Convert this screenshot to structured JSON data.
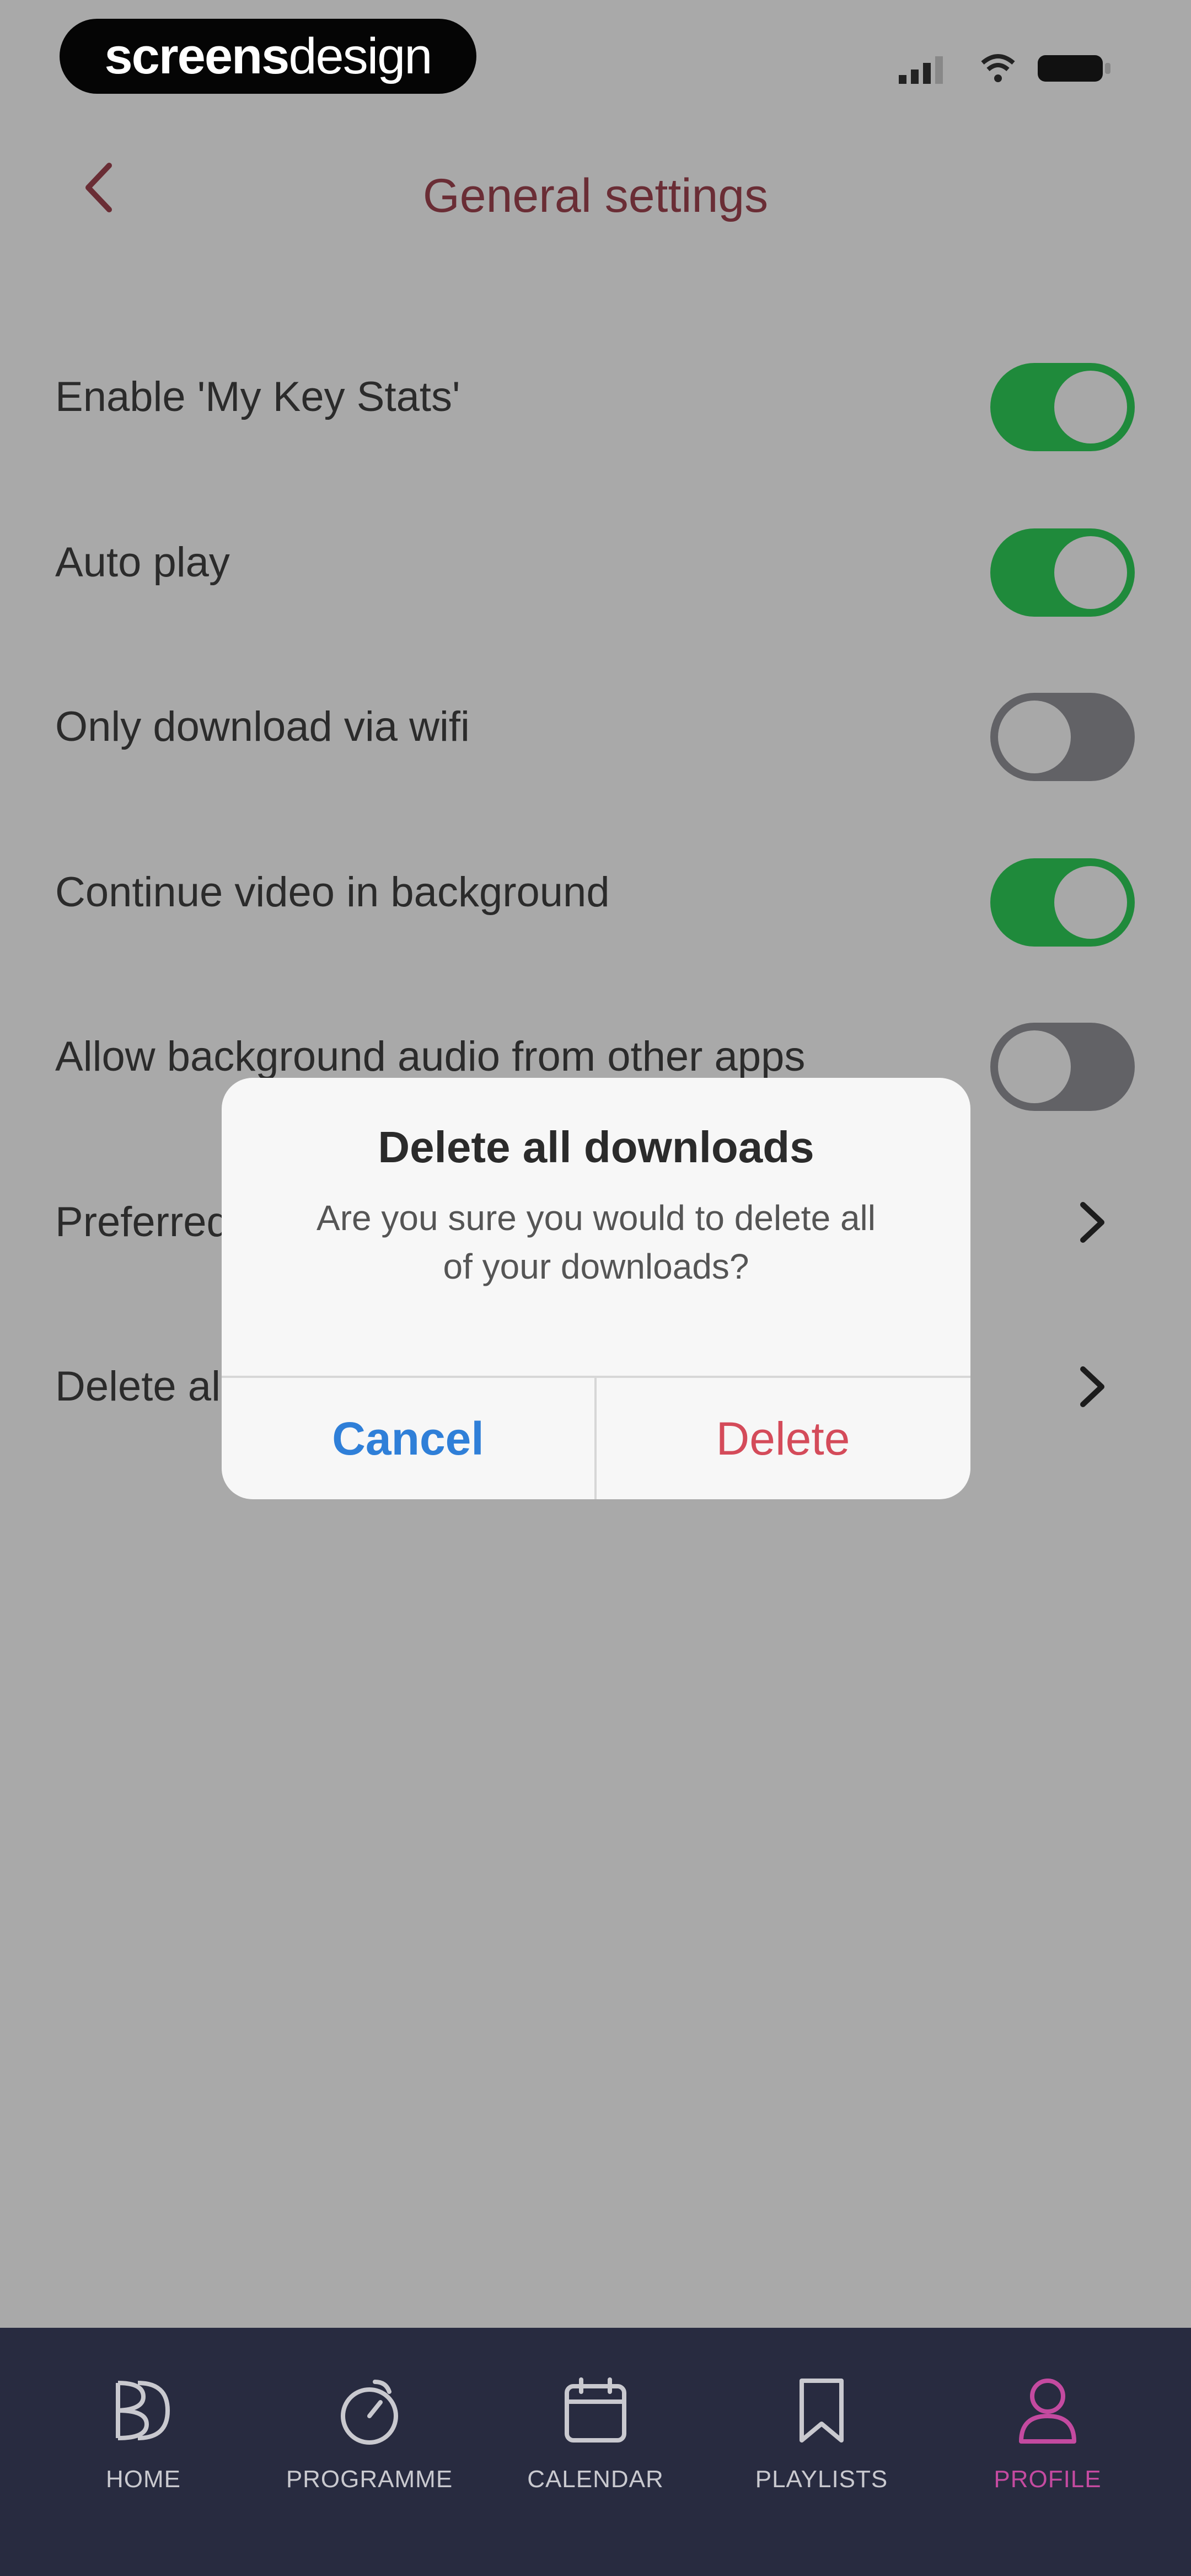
{
  "status_bar": {
    "brand_bold": "screens",
    "brand_light": "design"
  },
  "header": {
    "title": "General settings"
  },
  "settings": [
    {
      "label": "Enable 'My Key Stats'",
      "control": "toggle",
      "on": true
    },
    {
      "label": "Auto play",
      "control": "toggle",
      "on": true
    },
    {
      "label": "Only download via wifi",
      "control": "toggle",
      "on": false
    },
    {
      "label": "Continue video in background",
      "control": "toggle",
      "on": true
    },
    {
      "label": "Allow background audio from other apps",
      "control": "toggle",
      "on": false
    },
    {
      "label": "Preferred",
      "control": "chevron"
    },
    {
      "label": "Delete al",
      "control": "chevron"
    }
  ],
  "dialog": {
    "title": "Delete all downloads",
    "message_line1": "Are you sure you would to delete all",
    "message_line2": "of your downloads?",
    "cancel_label": "Cancel",
    "delete_label": "Delete"
  },
  "tabs": [
    {
      "label": "HOME",
      "icon": "home-logo-icon",
      "active": false
    },
    {
      "label": "PROGRAMME",
      "icon": "programme-icon",
      "active": false
    },
    {
      "label": "CALENDAR",
      "icon": "calendar-icon",
      "active": false
    },
    {
      "label": "PLAYLISTS",
      "icon": "bookmark-icon",
      "active": false
    },
    {
      "label": "PROFILE",
      "icon": "profile-icon",
      "active": true
    }
  ],
  "colors": {
    "toggle_on": "#1f8a3b",
    "toggle_off": "#626266",
    "title": "#6a2d35",
    "tab_bar": "#282b40",
    "tab_active": "#c44aa0",
    "cancel": "#2f7fd8",
    "delete": "#d44b5a"
  }
}
